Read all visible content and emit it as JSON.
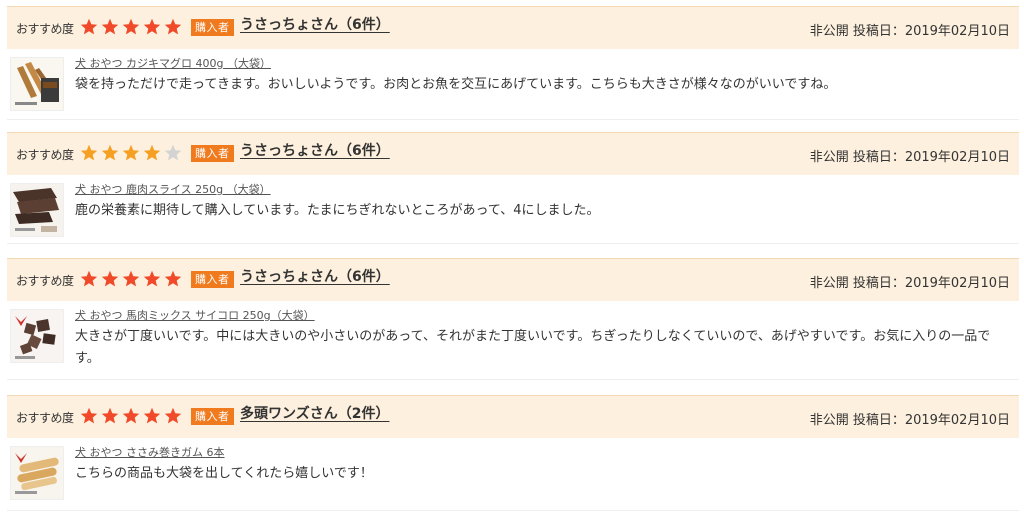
{
  "labels": {
    "recommend": "おすすめ度",
    "buyer_badge": "購入者"
  },
  "colors": {
    "star_filled": "#f04a2a",
    "star_partial": "#f5a023",
    "star_empty": "#d3d3d3",
    "header_bg": "#fdf0de",
    "badge_bg": "#f07a1e"
  },
  "reviews": [
    {
      "rating": 5,
      "reviewer": "うさっちょさん（6件）",
      "meta": "非公開 投稿日：2019年02月10日",
      "product": "犬 おやつ カジキマグロ 400g （大袋）",
      "thumb_icon": "jerky-thumbnail-icon",
      "comment": "袋を持っただけで走ってきます。おいしいようです。お肉とお魚を交互にあげています。こちらも大きさが様々なのがいいですね。"
    },
    {
      "rating": 4,
      "reviewer": "うさっちょさん（6件）",
      "meta": "非公開 投稿日：2019年02月10日",
      "product": "犬 おやつ 鹿肉スライス 250g （大袋）",
      "thumb_icon": "venison-thumbnail-icon",
      "comment": "鹿の栄養素に期待して購入しています。たまにちぎれないところがあって、4にしました。"
    },
    {
      "rating": 5,
      "reviewer": "うさっちょさん（6件）",
      "meta": "非公開 投稿日：2019年02月10日",
      "product": "犬 おやつ 馬肉ミックス サイコロ 250g（大袋）",
      "thumb_icon": "horse-meat-thumbnail-icon",
      "comment": "大きさが丁度いいです。中には大きいのや小さいのがあって、それがまた丁度いいです。ちぎったりしなくていいので、あげやすいです。お気に入りの一品です。"
    },
    {
      "rating": 5,
      "reviewer": "多頭ワンズさん（2件）",
      "meta": "非公開 投稿日：2019年02月10日",
      "product": "犬 おやつ ささみ巻きガム 6本",
      "thumb_icon": "chicken-gum-thumbnail-icon",
      "comment": "こちらの商品も大袋を出してくれたら嬉しいです！"
    }
  ]
}
